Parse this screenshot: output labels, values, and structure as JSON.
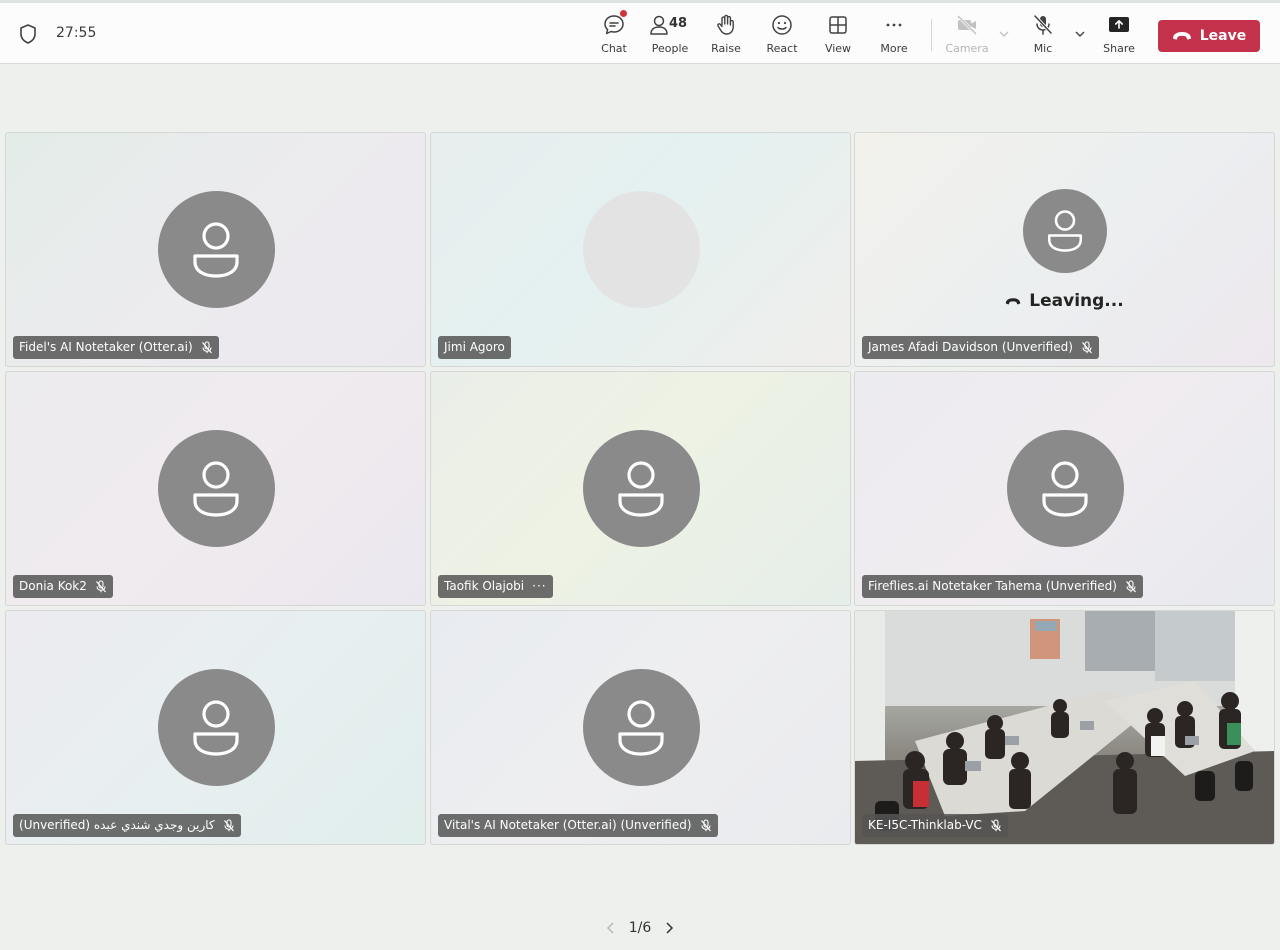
{
  "toolbar": {
    "timer": "27:55",
    "chat_label": "Chat",
    "people_label": "People",
    "people_count": "48",
    "raise_label": "Raise",
    "react_label": "React",
    "view_label": "View",
    "more_label": "More",
    "camera_label": "Camera",
    "mic_label": "Mic",
    "share_label": "Share",
    "leave_label": "Leave"
  },
  "tiles": [
    {
      "name": "Fidel's AI Notetaker (Otter.ai)",
      "muted": true,
      "avatar": "person-icon"
    },
    {
      "name": "Jimi Agoro",
      "muted": false,
      "avatar": "blank"
    },
    {
      "name": "James Afadi Davidson (Unverified)",
      "muted": true,
      "avatar": "person-icon",
      "status": "Leaving..."
    },
    {
      "name": "Donia Kok2",
      "muted": true,
      "avatar": "person-icon"
    },
    {
      "name": "Taofik Olajobi",
      "muted": false,
      "avatar": "person-icon",
      "more": "···"
    },
    {
      "name": "Fireflies.ai Notetaker Tahema (Unverified)",
      "muted": true,
      "avatar": "person-icon"
    },
    {
      "name": "كارين وجدي شندي عبده (Unverified)",
      "muted": true,
      "avatar": "person-icon"
    },
    {
      "name": "Vital's AI Notetaker (Otter.ai) (Unverified)",
      "muted": true,
      "avatar": "person-icon"
    },
    {
      "name": "KE-I5C-Thinklab-VC",
      "muted": true,
      "avatar": "video"
    }
  ],
  "pager": {
    "label": "1/6"
  },
  "colors": {
    "leave": "#c4314b",
    "avatar": "#8a8a8a",
    "notification": "#d13438"
  }
}
